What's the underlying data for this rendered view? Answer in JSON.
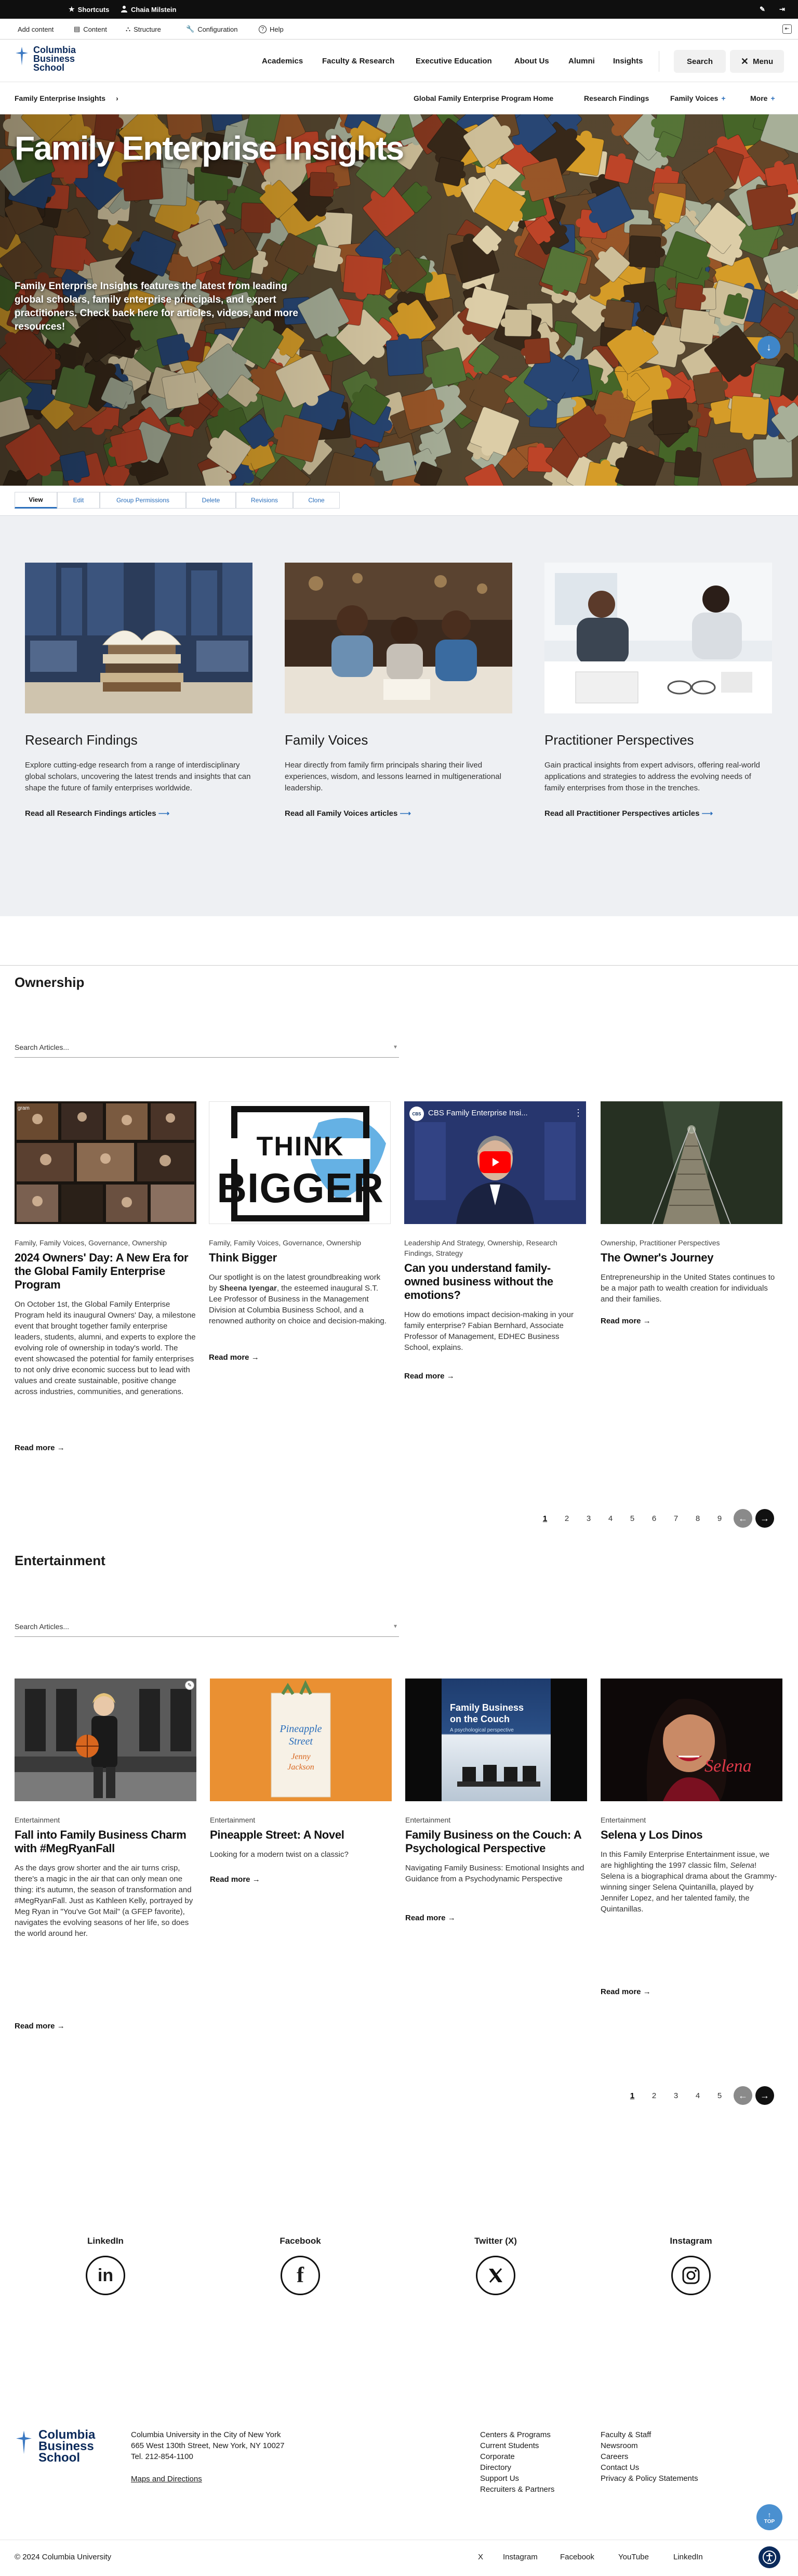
{
  "admin_toolbar": {
    "shortcuts": "Shortcuts",
    "user": "Chaia Milstein",
    "add_content": "Add content",
    "content": "Content",
    "structure": "Structure",
    "configuration": "Configuration",
    "help": "Help"
  },
  "header": {
    "logo_line1": "Columbia",
    "logo_line2": "Business",
    "logo_line3": "School",
    "nav": [
      "Academics",
      "Faculty & Research",
      "Executive Education",
      "About Us",
      "Alumni",
      "Insights"
    ],
    "search_label": "Search",
    "menu_label": "Menu"
  },
  "subnav": {
    "section": "Family Enterprise Insights",
    "links": [
      "Global Family Enterprise Program Home",
      "Research Findings",
      "Family Voices",
      "More"
    ]
  },
  "hero": {
    "title": "Family Enterprise Insights",
    "text": "Family Enterprise Insights features the latest from leading global scholars, family enterprise principals, and expert practitioners. Check back here for articles, videos, and more resources!"
  },
  "local_tasks": [
    "View",
    "Edit",
    "Group Permissions",
    "Delete",
    "Revisions",
    "Clone"
  ],
  "topics": [
    {
      "title": "Research Findings",
      "text": "Explore cutting-edge research from a range of interdisciplinary global scholars, uncovering the latest trends and insights that can shape the future of family enterprises worldwide.",
      "link": "Read all Research Findings articles"
    },
    {
      "title": "Family Voices",
      "text": "Hear directly from family firm principals sharing their lived experiences, wisdom, and lessons learned in multigenerational leadership.",
      "link": "Read all Family Voices articles"
    },
    {
      "title": "Practitioner Perspectives",
      "text": "Gain practical insights from expert advisors, offering real-world applications and strategies to address the evolving needs of family enterprises from those in the trenches.",
      "link": "Read all Practitioner Perspectives articles"
    }
  ],
  "ownership": {
    "heading": "Ownership",
    "search_placeholder": "Search Articles...",
    "articles": [
      {
        "tags": "Family, Family Voices, Governance, Ownership",
        "title": "2024 Owners' Day: A New Era for the Global Family Enterprise Program",
        "text": "On October 1st, the Global Family Enterprise Program held its inaugural Owners' Day, a milestone event that brought together family enterprise leaders, students, alumni, and experts to explore the evolving role of ownership in today's world. The event showcased the potential for family enterprises to not only drive economic success but to lead with values and create sustainable, positive change across industries, communities, and generations.",
        "read_more": "Read more"
      },
      {
        "tags": "Family, Family Voices, Governance, Ownership",
        "title": "Think Bigger",
        "text_before": "Our spotlight is on the latest groundbreaking work by ",
        "text_bold": "Sheena Iyengar",
        "text_after": ", the esteemed inaugural S.T. Lee Professor of Business in the Management Division at Columbia Business School, and a renowned authority on choice and decision-making.",
        "image_word1": "THINK",
        "image_word2": "BIGGER",
        "read_more": "Read more"
      },
      {
        "tags": "Leadership And Strategy, Ownership, Research Findings, Strategy",
        "title": "Can you understand family-owned business without the emotions?",
        "text": "How do emotions impact decision-making in your family enterprise? Fabian Bernhard, Associate Professor of Management, EDHEC Business School, explains.",
        "video_title": "CBS Family Enterprise Insi...",
        "read_more": "Read more"
      },
      {
        "tags": "Ownership, Practitioner Perspectives",
        "title": "The Owner's Journey",
        "text": "Entrepreneurship in the United States continues to be a major path to wealth creation for individuals and their families.",
        "read_more": "Read more"
      }
    ],
    "pages": [
      "1",
      "2",
      "3",
      "4",
      "5",
      "6",
      "7",
      "8",
      "9"
    ]
  },
  "entertainment": {
    "heading": "Entertainment",
    "search_placeholder": "Search Articles...",
    "articles": [
      {
        "tags": "Entertainment",
        "title": "Fall into Family Business Charm with #MegRyanFall",
        "text": "As the days grow shorter and the air turns crisp, there's a magic in the air that can only mean one thing: it's autumn, the season of transformation and #MegRyanFall. Just as Kathleen Kelly, portrayed by Meg Ryan in \"You've Got Mail\" (a GFEP favorite), navigates the evolving seasons of her life, so does the world around her.",
        "read_more": "Read more"
      },
      {
        "tags": "Entertainment",
        "title": "Pineapple Street: A Novel",
        "text": "Looking for a modern twist on a classic?",
        "image_words": [
          "Pineapple",
          "Street",
          "Jenny",
          "Jackson"
        ],
        "read_more": "Read more"
      },
      {
        "tags": "Entertainment",
        "title": "Family Business on the Couch: A Psychological Perspective",
        "text": "Navigating Family Business: Emotional Insights and Guidance from a Psychodynamic Perspective",
        "image_title_line1": "Family Business",
        "image_title_line2": "on the Couch",
        "image_subtitle": "A psychological perspective",
        "read_more": "Read more"
      },
      {
        "tags": "Entertainment",
        "title": "Selena y Los Dinos",
        "text_before": "In this Family Enterprise Entertainment issue, we are highlighting the 1997 classic film, ",
        "text_italic": "Selena",
        "text_after": "! Selena is a biographical drama about the Grammy-winning singer Selena Quintanilla, played by Jennifer Lopez, and her talented family, the Quintanillas.",
        "image_script": "Selena",
        "read_more": "Read more"
      }
    ],
    "pages": [
      "1",
      "2",
      "3",
      "4",
      "5"
    ]
  },
  "social": [
    {
      "label": "LinkedIn",
      "icon": "linkedin-icon"
    },
    {
      "label": "Facebook",
      "icon": "facebook-icon"
    },
    {
      "label": "Twitter (X)",
      "icon": "x-icon"
    },
    {
      "label": "Instagram",
      "icon": "instagram-icon"
    }
  ],
  "footer": {
    "logo_line1": "Columbia",
    "logo_line2": "Business",
    "logo_line3": "School",
    "address": [
      "Columbia University in the City of New York",
      "665 West 130th Street, New York, NY 10027",
      "Tel. 212-854-1100"
    ],
    "maps": "Maps and Directions",
    "col1": [
      "Centers & Programs",
      "Current Students",
      "Corporate",
      "Directory",
      "Support Us",
      "Recruiters & Partners"
    ],
    "col2": [
      "Faculty & Staff",
      "Newsroom",
      "Careers",
      "Contact Us",
      "Privacy & Policy Statements"
    ],
    "copyright": "© 2024 Columbia University",
    "social_links": [
      "X",
      "Instagram",
      "Facebook",
      "YouTube",
      "LinkedIn"
    ],
    "top_label": "TOP"
  },
  "colors": {
    "accent": "#2a6ebb",
    "toolbar": "#0f0f0f",
    "section_bg": "#eef0f3",
    "navy": "#0b2a5b"
  }
}
